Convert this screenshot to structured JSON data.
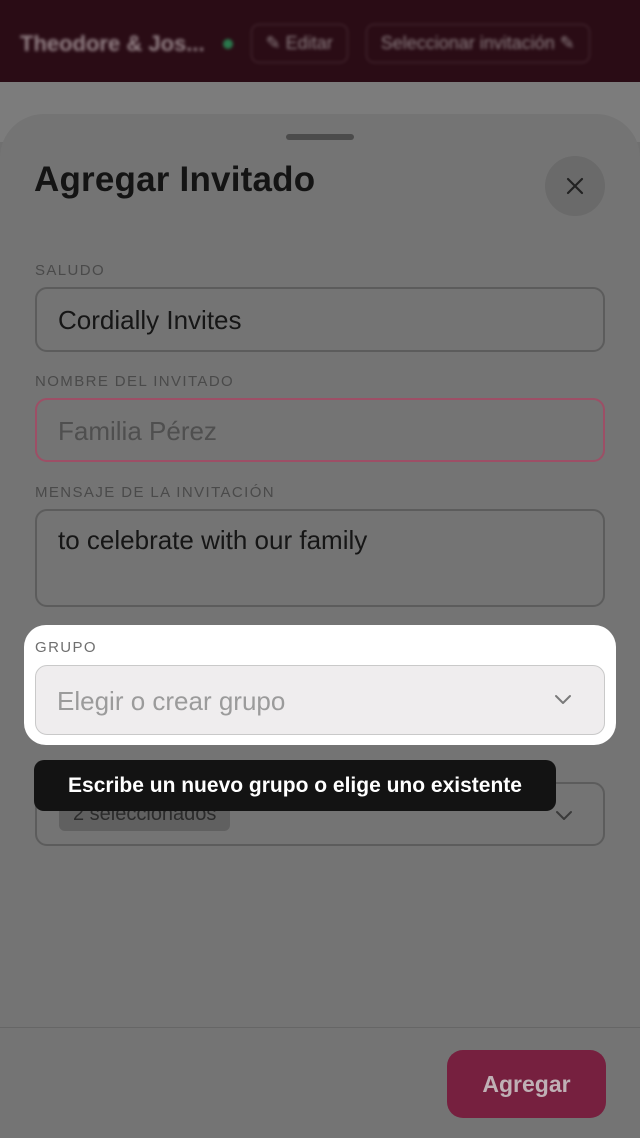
{
  "background": {
    "title": "Theodore & Jos...",
    "edit_label": "✎ Editar",
    "select_label": "Seleccionar invitación ✎"
  },
  "sheet": {
    "title": "Agregar Invitado",
    "close_icon": "close-icon"
  },
  "fields": {
    "salutation": {
      "label": "SALUDO",
      "value": "Cordially Invites"
    },
    "guest_name": {
      "label": "NOMBRE DEL INVITADO",
      "placeholder": "Familia Pérez"
    },
    "message": {
      "label": "MENSAJE DE LA INVITACIÓN",
      "value": "to celebrate with our family"
    },
    "group": {
      "label": "GRUPO",
      "placeholder": "Elegir o crear grupo"
    },
    "events": {
      "chip": "2 seleccionados"
    }
  },
  "tooltip": {
    "text": "Escribe un nuevo grupo o elige uno existente"
  },
  "footer": {
    "add_label": "Agregar"
  },
  "colors": {
    "accent": "#c4145e",
    "header_bg": "#2a0c15",
    "tooltip_bg": "#131313"
  }
}
